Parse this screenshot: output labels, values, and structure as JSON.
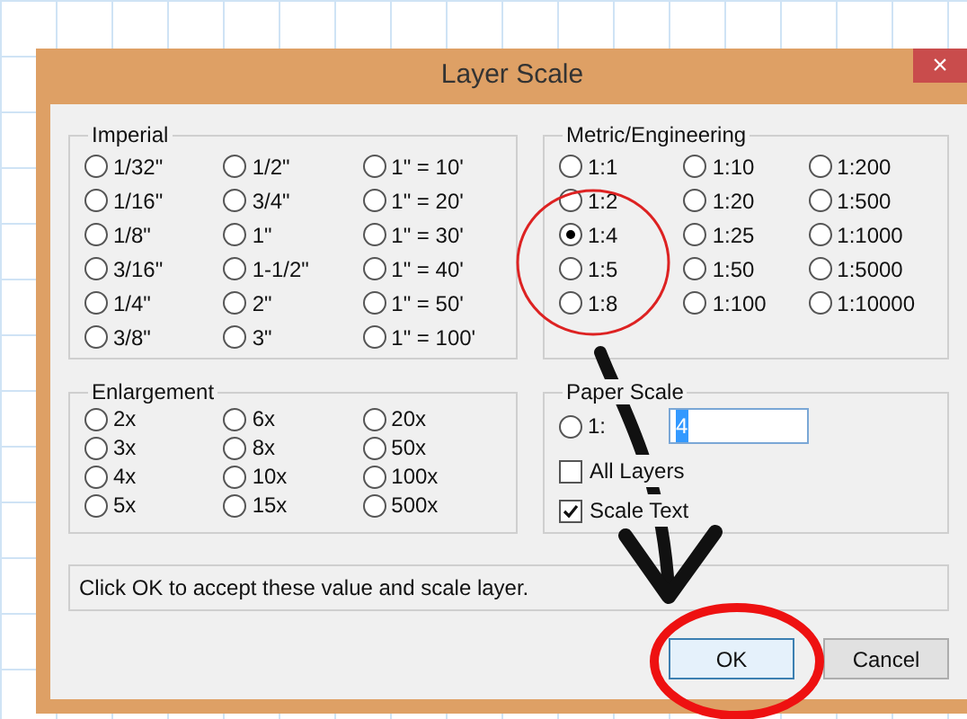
{
  "window": {
    "title": "Layer Scale",
    "close": "×"
  },
  "imperial": {
    "label": "Imperial",
    "options": [
      {
        "label": "1/32\"",
        "selected": false
      },
      {
        "label": "1/16\"",
        "selected": false
      },
      {
        "label": "1/8\"",
        "selected": false
      },
      {
        "label": "3/16\"",
        "selected": false
      },
      {
        "label": "1/4\"",
        "selected": false
      },
      {
        "label": "3/8\"",
        "selected": false
      },
      {
        "label": "1/2\"",
        "selected": false
      },
      {
        "label": "3/4\"",
        "selected": false
      },
      {
        "label": "1\"",
        "selected": false
      },
      {
        "label": "1-1/2\"",
        "selected": false
      },
      {
        "label": "2\"",
        "selected": false
      },
      {
        "label": "3\"",
        "selected": false
      },
      {
        "label": "1\" = 10'",
        "selected": false
      },
      {
        "label": "1\" = 20'",
        "selected": false
      },
      {
        "label": "1\" = 30'",
        "selected": false
      },
      {
        "label": "1\" = 40'",
        "selected": false
      },
      {
        "label": "1\" = 50'",
        "selected": false
      },
      {
        "label": "1\" = 100'",
        "selected": false
      }
    ]
  },
  "metric": {
    "label": "Metric/Engineering",
    "options": [
      {
        "label": "1:1",
        "selected": false
      },
      {
        "label": "1:2",
        "selected": false
      },
      {
        "label": "1:4",
        "selected": true
      },
      {
        "label": "1:5",
        "selected": false
      },
      {
        "label": "1:8",
        "selected": false
      },
      {
        "label": "1:10",
        "selected": false
      },
      {
        "label": "1:20",
        "selected": false
      },
      {
        "label": "1:25",
        "selected": false
      },
      {
        "label": "1:50",
        "selected": false
      },
      {
        "label": "1:100",
        "selected": false
      },
      {
        "label": "1:200",
        "selected": false
      },
      {
        "label": "1:500",
        "selected": false
      },
      {
        "label": "1:1000",
        "selected": false
      },
      {
        "label": "1:5000",
        "selected": false
      },
      {
        "label": "1:10000",
        "selected": false
      }
    ]
  },
  "enlargement": {
    "label": "Enlargement",
    "options": [
      {
        "label": "2x",
        "selected": false
      },
      {
        "label": "3x",
        "selected": false
      },
      {
        "label": "4x",
        "selected": false
      },
      {
        "label": "5x",
        "selected": false
      },
      {
        "label": "6x",
        "selected": false
      },
      {
        "label": "8x",
        "selected": false
      },
      {
        "label": "10x",
        "selected": false
      },
      {
        "label": "15x",
        "selected": false
      },
      {
        "label": "20x",
        "selected": false
      },
      {
        "label": "50x",
        "selected": false
      },
      {
        "label": "100x",
        "selected": false
      },
      {
        "label": "500x",
        "selected": false
      }
    ]
  },
  "paper_scale": {
    "label": "Paper Scale",
    "radio": {
      "label": "1:",
      "selected": false
    },
    "value": "4",
    "checkboxes": [
      {
        "label": "All Layers",
        "checked": false
      },
      {
        "label": "Scale Text",
        "checked": true
      }
    ]
  },
  "message": "Click OK to accept these value and scale layer.",
  "buttons": [
    {
      "label": "OK",
      "default": true
    },
    {
      "label": "Cancel",
      "default": false
    }
  ]
}
